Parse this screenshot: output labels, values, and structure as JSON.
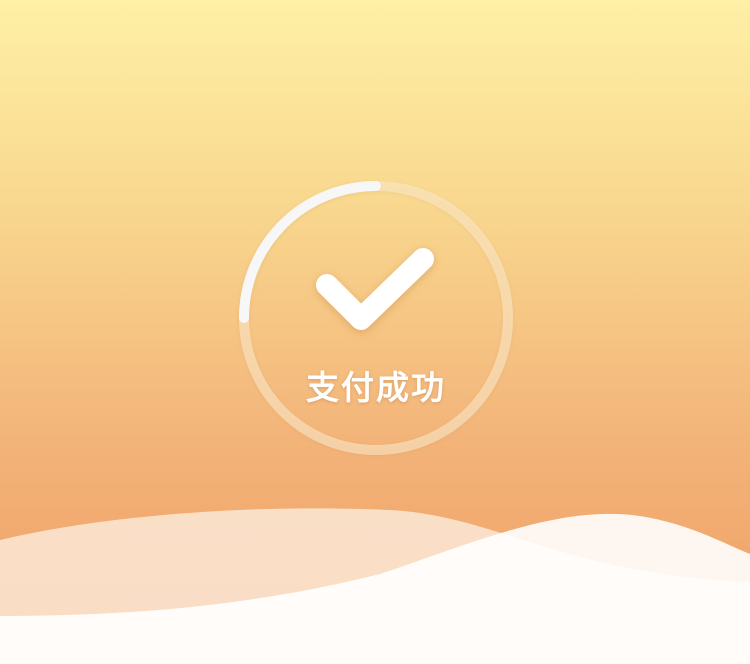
{
  "status": {
    "text": "支付成功",
    "icon": "checkmark-icon",
    "progress": 0.25
  },
  "colors": {
    "gradient_top": "#FEF0A6",
    "gradient_bottom": "#EF9C63",
    "text": "#FFFFFF",
    "ring_track": "#FCE8C8",
    "ring_progress": "#F7F7F7",
    "wave_back": "#FBE7D6",
    "wave_front": "#FFFFFF"
  }
}
